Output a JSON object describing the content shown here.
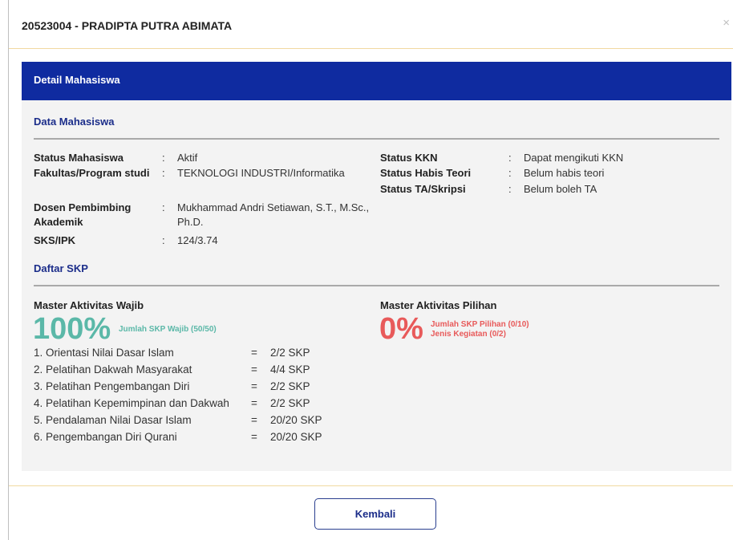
{
  "header": {
    "title": "20523004 - PRADIPTA PUTRA ABIMATA",
    "close": "×"
  },
  "panel": {
    "title": "Detail Mahasiswa",
    "data_title": "Data Mahasiswa",
    "left_info": [
      {
        "label": "Status Mahasiswa",
        "value": "Aktif"
      },
      {
        "label": "Fakultas/Program studi",
        "value": "TEKNOLOGI INDUSTRI/Informatika"
      },
      {
        "label": "Dosen Pembimbing Akademik",
        "value": "Mukhammad Andri Setiawan, S.T., M.Sc., Ph.D."
      },
      {
        "label": "SKS/IPK",
        "value": "124/3.74"
      }
    ],
    "right_info": [
      {
        "label": "Status KKN",
        "value": "Dapat mengikuti KKN"
      },
      {
        "label": "Status Habis Teori",
        "value": "Belum habis teori"
      },
      {
        "label": "Status TA/Skripsi",
        "value": "Belum boleh TA"
      }
    ],
    "colon": ":",
    "skp_title": "Daftar SKP",
    "wajib": {
      "title": "Master Aktivitas Wajib",
      "percent": "100%",
      "caption": "Jumlah SKP Wajib (50/50)",
      "items": [
        {
          "name": "1. Orientasi Nilai Dasar Islam",
          "eq": "=",
          "value": "2/2 SKP"
        },
        {
          "name": "2. Pelatihan Dakwah Masyarakat",
          "eq": "=",
          "value": "4/4 SKP"
        },
        {
          "name": "3. Pelatihan Pengembangan Diri",
          "eq": "=",
          "value": "2/2 SKP"
        },
        {
          "name": "4. Pelatihan Kepemimpinan dan Dakwah",
          "eq": "=",
          "value": "2/2 SKP"
        },
        {
          "name": "5. Pendalaman Nilai Dasar Islam",
          "eq": "=",
          "value": "20/20 SKP"
        },
        {
          "name": "6. Pengembangan Diri Qurani",
          "eq": "=",
          "value": "20/20 SKP"
        }
      ]
    },
    "pilihan": {
      "title": "Master Aktivitas Pilihan",
      "percent": "0%",
      "caption_1": "Jumlah SKP Pilihan (0/10)",
      "caption_2": "Jenis Kegiatan (0/2)"
    }
  },
  "footer": {
    "button_label": "Kembali"
  }
}
